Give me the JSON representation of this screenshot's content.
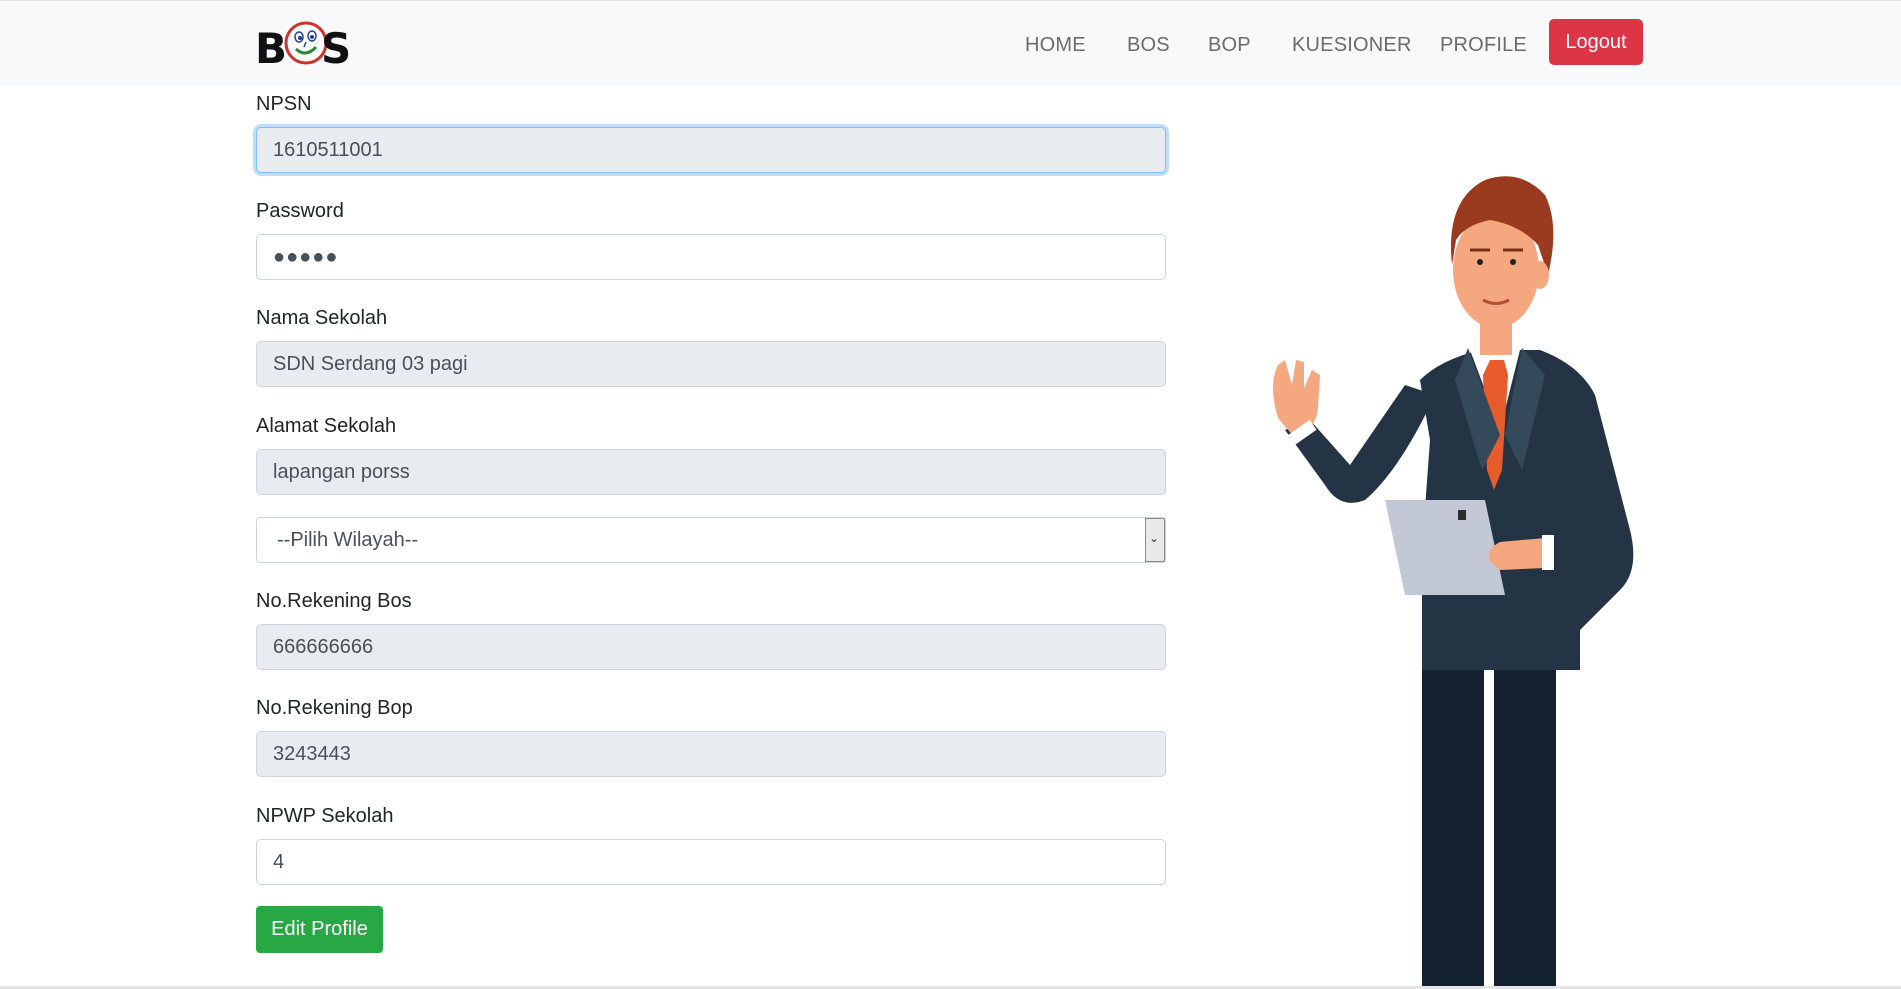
{
  "navbar": {
    "brand": {
      "left": "B",
      "right": "S"
    },
    "items": [
      {
        "label": "HOME"
      },
      {
        "label": "BOS"
      },
      {
        "label": "BOP"
      },
      {
        "label": "KUESIONER"
      },
      {
        "label": "PROFILE"
      }
    ],
    "logout_label": "Logout"
  },
  "form": {
    "npsn": {
      "label": "NPSN",
      "value": "1610511001"
    },
    "password": {
      "label": "Password",
      "value": "●●●●●"
    },
    "nama_sekolah": {
      "label": "Nama Sekolah",
      "value": "SDN Serdang 03 pagi"
    },
    "alamat_sekolah": {
      "label": "Alamat Sekolah",
      "value": "lapangan porss"
    },
    "wilayah": {
      "selected": "--Pilih Wilayah--"
    },
    "rekening_bos": {
      "label": "No.Rekening Bos",
      "value": "666666666"
    },
    "rekening_bop": {
      "label": "No.Rekening Bop",
      "value": "3243443"
    },
    "npwp": {
      "label": "NPWP Sekolah",
      "value": "4"
    },
    "submit_label": "Edit Profile"
  },
  "colors": {
    "navbar_bg": "#f8f9fa",
    "logout": "#dc3545",
    "submit": "#28a745",
    "readonly_field": "#e9ecef"
  }
}
